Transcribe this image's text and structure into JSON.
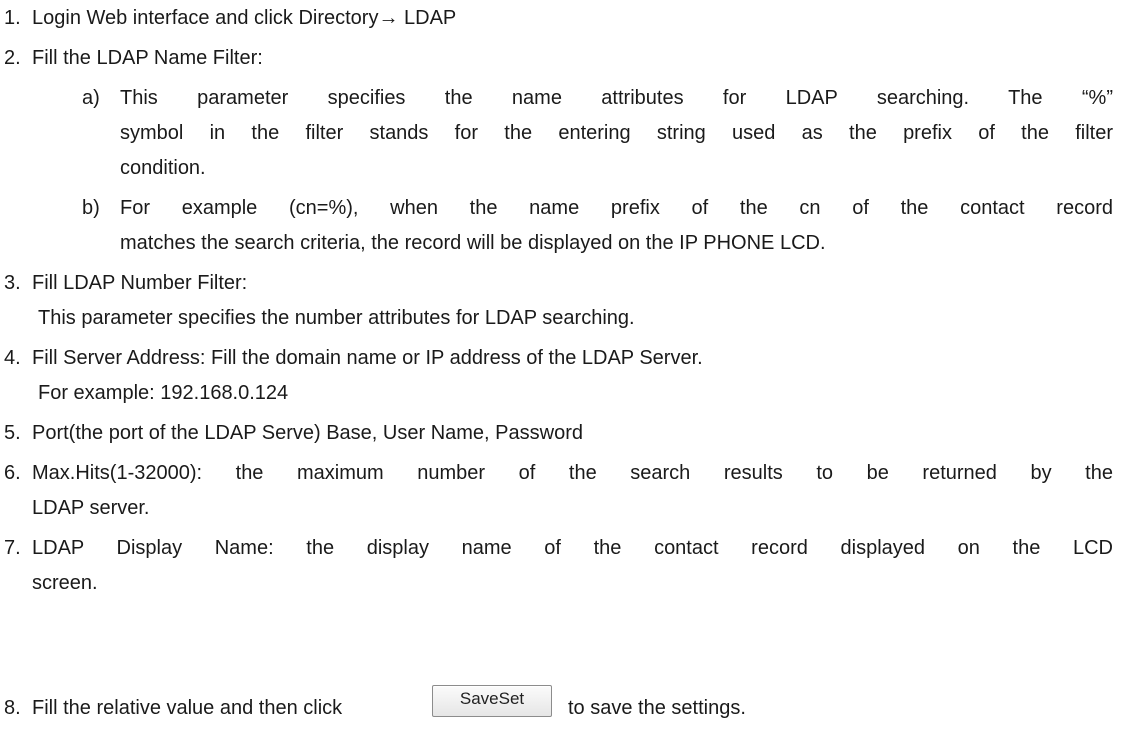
{
  "steps": [
    {
      "num": "1.",
      "lines": [
        "Login Web interface and click Directory→ LDAP"
      ]
    },
    {
      "num": "2.",
      "lines": [
        "Fill the LDAP Name Filter:"
      ],
      "subs": [
        {
          "marker": "a)",
          "lines": [
            "This parameter specifies the name attributes for LDAP searching. The “%”",
            "symbol in the filter stands for the entering string used as the prefix of the filter",
            "condition."
          ]
        },
        {
          "marker": "b)",
          "lines": [
            "For example (cn=%), when the name prefix of the cn of the contact record",
            "matches the search criteria, the record will be displayed on the IP PHONE LCD."
          ]
        }
      ]
    },
    {
      "num": "3.",
      "lines": [
        "Fill LDAP Number Filter:",
        "This parameter specifies the number attributes for LDAP searching."
      ]
    },
    {
      "num": "4.",
      "lines": [
        "Fill Server Address: Fill the domain name or IP address of the LDAP Server.",
        "For example: 192.168.0.124"
      ]
    },
    {
      "num": "5.",
      "lines": [
        "Port(the port of the LDAP Serve) Base, User Name, Password"
      ]
    },
    {
      "num": "6.",
      "lines": [
        "Max.Hits(1-32000): the maximum number of the search results to be returned by the",
        "LDAP server."
      ]
    },
    {
      "num": "7.",
      "lines": [
        "LDAP Display Name: the display name of the contact record displayed on the LCD",
        "screen."
      ]
    },
    {
      "num": "8.",
      "before_button": "Fill the relative value and then click",
      "button_label": "SaveSet",
      "after_button": "to save the settings."
    }
  ]
}
